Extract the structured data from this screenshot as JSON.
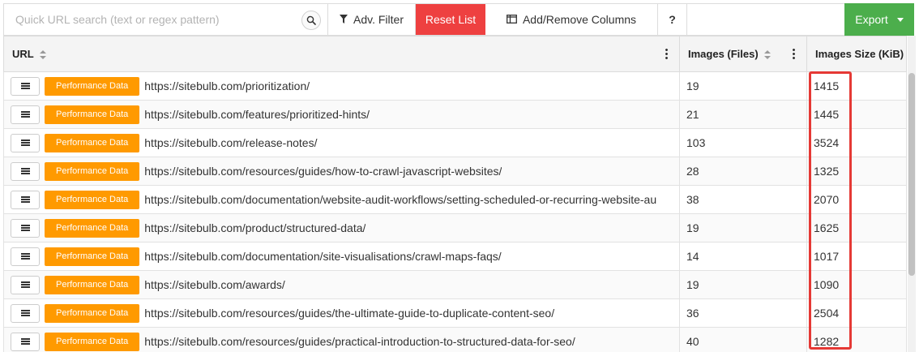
{
  "toolbar": {
    "search_placeholder": "Quick URL search (text or regex pattern)",
    "adv_filter_label": "Adv. Filter",
    "reset_label": "Reset List",
    "columns_label": "Add/Remove Columns",
    "help_label": "?",
    "export_label": "Export",
    "icons": {
      "search": "search-icon",
      "filter": "filter-icon",
      "columns": "columns-icon",
      "dropdown": "caret-down-icon"
    },
    "colors": {
      "reset_bg": "#ee4040",
      "export_bg": "#4cae4c"
    }
  },
  "table": {
    "columns": [
      "URL",
      "Images (Files)",
      "Images Size (KiB)"
    ],
    "action_label": "Performance Data",
    "accent_color": "#ff9a00",
    "rows": [
      {
        "url": "https://sitebulb.com/prioritization/",
        "files": "19",
        "size": "1415"
      },
      {
        "url": "https://sitebulb.com/features/prioritized-hints/",
        "files": "21",
        "size": "1445"
      },
      {
        "url": "https://sitebulb.com/release-notes/",
        "files": "103",
        "size": "3524"
      },
      {
        "url": "https://sitebulb.com/resources/guides/how-to-crawl-javascript-websites/",
        "files": "28",
        "size": "1325"
      },
      {
        "url": "https://sitebulb.com/documentation/website-audit-workflows/setting-scheduled-or-recurring-website-au",
        "files": "38",
        "size": "2070"
      },
      {
        "url": "https://sitebulb.com/product/structured-data/",
        "files": "19",
        "size": "1625"
      },
      {
        "url": "https://sitebulb.com/documentation/site-visualisations/crawl-maps-faqs/",
        "files": "14",
        "size": "1017"
      },
      {
        "url": "https://sitebulb.com/awards/",
        "files": "19",
        "size": "1090"
      },
      {
        "url": "https://sitebulb.com/resources/guides/the-ultimate-guide-to-duplicate-content-seo/",
        "files": "36",
        "size": "2504"
      },
      {
        "url": "https://sitebulb.com/resources/guides/practical-introduction-to-structured-data-for-seo/",
        "files": "40",
        "size": "1282"
      }
    ]
  },
  "highlight_color": "#e53935"
}
